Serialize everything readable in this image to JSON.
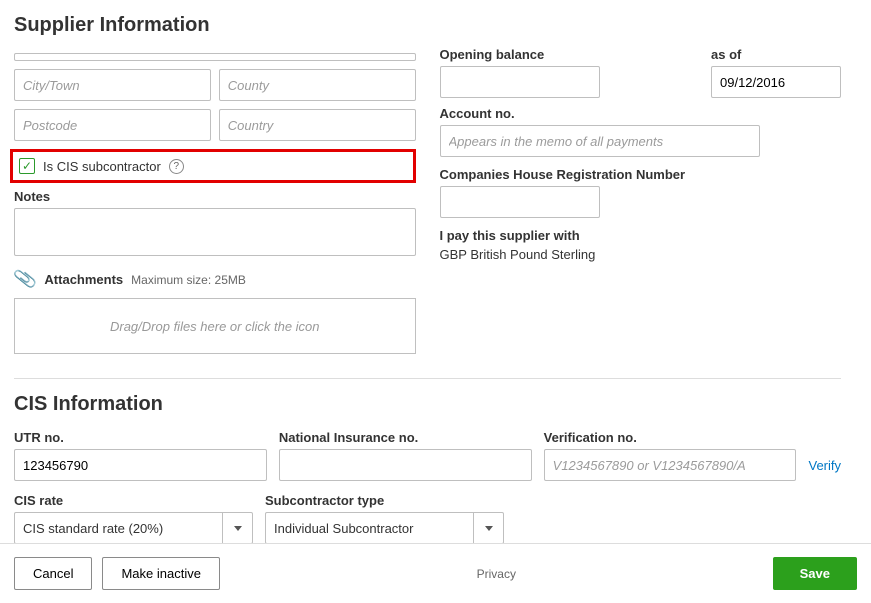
{
  "supplier_info": {
    "title": "Supplier Information",
    "city_ph": "City/Town",
    "county_ph": "County",
    "postcode_ph": "Postcode",
    "country_ph": "Country",
    "cis_checkbox_label": "Is CIS subcontractor",
    "notes_label": "Notes",
    "attachments_label": "Attachments",
    "attachments_hint": "Maximum size: 25MB",
    "dropzone_text": "Drag/Drop files here or click the icon",
    "opening_balance_label": "Opening balance",
    "as_of_label": "as of",
    "as_of_value": "09/12/2016",
    "account_no_label": "Account no.",
    "account_no_ph": "Appears in the memo of all payments",
    "companies_house_label": "Companies House Registration Number",
    "pay_with_label": "I pay this supplier with",
    "pay_with_value": "GBP British Pound Sterling"
  },
  "cis_info": {
    "title": "CIS Information",
    "utr_label": "UTR no.",
    "utr_value": "123456790",
    "ni_label": "National Insurance no.",
    "verification_label": "Verification no.",
    "verification_ph": "V1234567890 or V1234567890/A",
    "verify_link": "Verify",
    "cis_rate_label": "CIS rate",
    "cis_rate_value": "CIS standard rate (20%)",
    "subcontractor_type_label": "Subcontractor type",
    "subcontractor_type_value": "Individual Subcontractor"
  },
  "footer": {
    "cancel": "Cancel",
    "make_inactive": "Make inactive",
    "privacy": "Privacy",
    "save": "Save"
  }
}
